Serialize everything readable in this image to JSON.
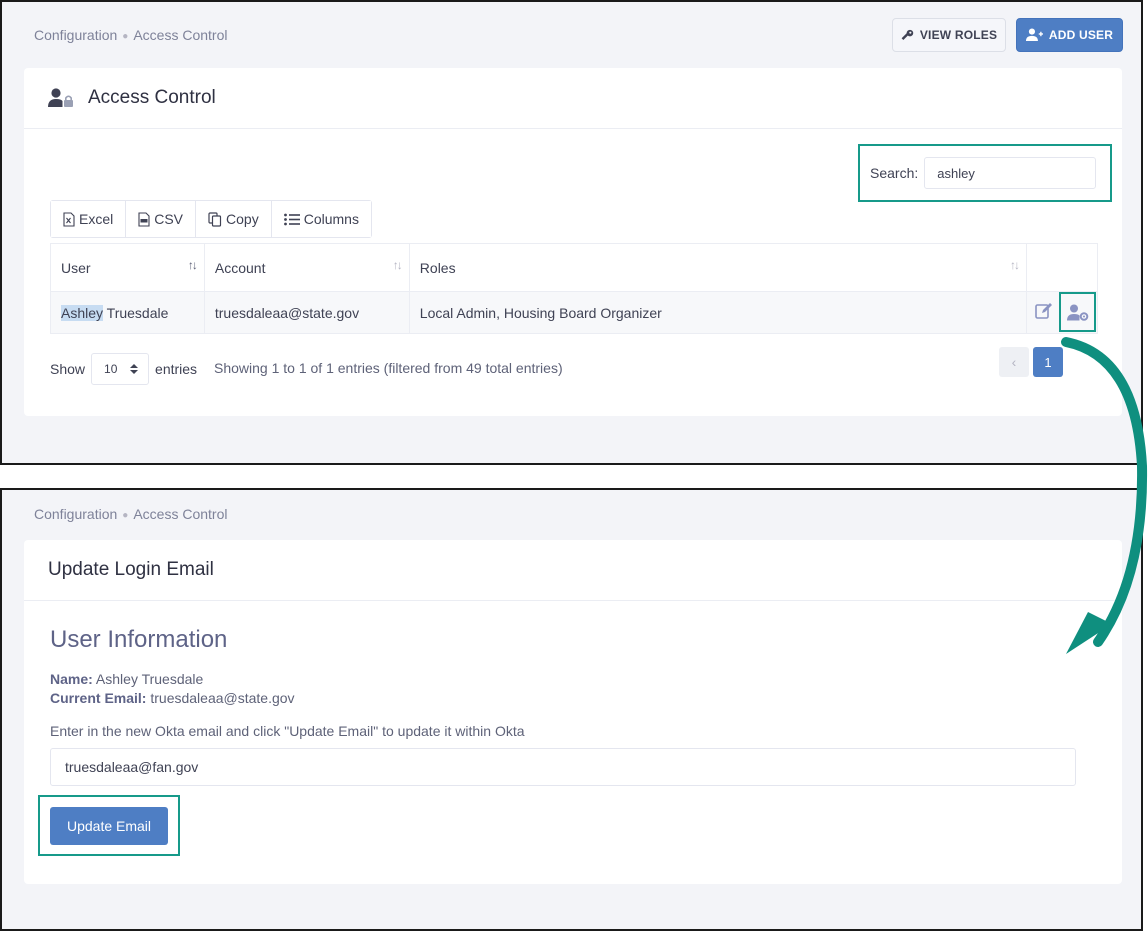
{
  "top": {
    "breadcrumb": {
      "section": "Configuration",
      "page": "Access Control"
    },
    "buttons": {
      "view_roles": "VIEW ROLES",
      "add_user": "ADD USER"
    },
    "card_title": "Access Control",
    "search": {
      "label": "Search:",
      "value": "ashley"
    },
    "export": {
      "excel": "Excel",
      "csv": "CSV",
      "copy": "Copy",
      "columns": "Columns"
    },
    "table": {
      "headers": {
        "user": "User",
        "account": "Account",
        "roles": "Roles"
      },
      "row": {
        "user_highlight": "Ashley",
        "user_rest": " Truesdale",
        "account": "truesdaleaa@state.gov",
        "roles": "Local Admin, Housing Board Organizer"
      }
    },
    "length": {
      "show": "Show",
      "value": "10",
      "entries": "entries"
    },
    "info": "Showing 1 to 1 of 1 entries (filtered from 49 total entries)",
    "pagination": {
      "current": "1"
    }
  },
  "bottom": {
    "breadcrumb": {
      "section": "Configuration",
      "page": "Access Control"
    },
    "card_title": "Update Login Email",
    "section_heading": "User Information",
    "name_label": "Name:",
    "name_value": "Ashley Truesdale",
    "email_label": "Current Email:",
    "email_value": "truesdaleaa@state.gov",
    "help_text": "Enter in the new Okta email and click \"Update Email\" to update it within Okta",
    "new_email_value": "truesdaleaa@fan.gov",
    "update_button": "Update Email"
  },
  "colors": {
    "accent": "#4e7ec4",
    "highlight_box": "#169a8a",
    "connector_arrow": "#0f8f7f"
  },
  "icons": [
    "key-icon",
    "user-plus-icon",
    "user-lock-icon",
    "file-excel-icon",
    "file-csv-icon",
    "copy-icon",
    "list-icon",
    "sort-icon",
    "edit-icon",
    "user-gear-icon",
    "chevron-left-icon",
    "select-arrows-icon"
  ]
}
